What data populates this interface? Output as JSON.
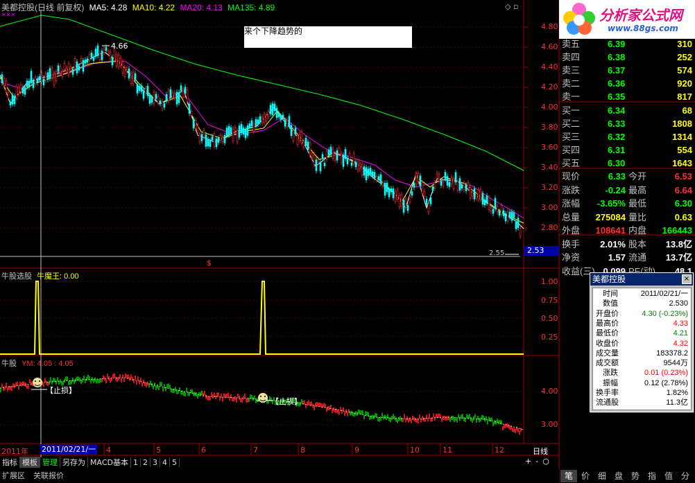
{
  "chart_header": {
    "title": "美都控股(日线 前复权)",
    "ma5": "MA5: 4.28",
    "ma10": "MA10: 4.22",
    "ma20": "MA20: 4.13",
    "ma135": "MA135: 4.89"
  },
  "annotation_text": "来个下降趋势的",
  "high_label": "4.66",
  "low_label": "2.55",
  "current_price_badge": "2.53",
  "dollar_marker": "$",
  "main_axis_ticks": [
    "4.80",
    "4.60",
    "4.40",
    "4.20",
    "4.00",
    "3.80",
    "3.60",
    "3.40",
    "3.20",
    "3.00",
    "2.80"
  ],
  "indicator1": {
    "title": "牛股选股",
    "sub": "牛魔王: 0.00",
    "ticks": [
      "1.00",
      "0.75",
      "0.50",
      "0.25"
    ]
  },
  "indicator2": {
    "title": "牛股",
    "sub": "YM: 4.05 : 4.05",
    "ticks": [
      "4.00",
      "3.00"
    ],
    "stop_label": "【止损】"
  },
  "date_axis": {
    "year": "2011年",
    "cursor": "2011/02/21/一",
    "months": [
      "4",
      "5",
      "6",
      "7",
      "8",
      "9",
      "10",
      "11",
      "12"
    ],
    "period": "日线"
  },
  "bottom_tabs": [
    "指标",
    "模板",
    "管理",
    "另存为",
    "MACD基本",
    "1",
    "2",
    "3",
    "4",
    "5"
  ],
  "bottom_tabs2": [
    "扩展区",
    "关联报价"
  ],
  "zoom_buttons": [
    "+",
    "-",
    "○"
  ],
  "logo": {
    "title": "分析家公式网",
    "url": "www.88gs.com"
  },
  "order_book": [
    {
      "label": "卖五",
      "price": "6.39",
      "vol": "310"
    },
    {
      "label": "卖四",
      "price": "6.38",
      "vol": "252"
    },
    {
      "label": "卖三",
      "price": "6.37",
      "vol": "574"
    },
    {
      "label": "卖二",
      "price": "6.36",
      "vol": "920"
    },
    {
      "label": "卖一",
      "price": "6.35",
      "vol": "817"
    },
    {
      "label": "买一",
      "price": "6.34",
      "vol": "68"
    },
    {
      "label": "买二",
      "price": "6.33",
      "vol": "1808"
    },
    {
      "label": "买三",
      "price": "6.32",
      "vol": "1314"
    },
    {
      "label": "买四",
      "price": "6.31",
      "vol": "554"
    },
    {
      "label": "买五",
      "price": "6.30",
      "vol": "1643"
    }
  ],
  "quote_stats": [
    {
      "k1": "现价",
      "v1": "6.33",
      "k2": "今开",
      "v2": "6.53"
    },
    {
      "k1": "涨跌",
      "v1": "-0.24",
      "k2": "最高",
      "v2": "6.64"
    },
    {
      "k1": "涨幅",
      "v1": "-3.65%",
      "k2": "最低",
      "v2": "6.30"
    },
    {
      "k1": "总量",
      "v1": "275084",
      "k2": "量比",
      "v2": "0.63"
    },
    {
      "k1": "外盘",
      "v1": "108641",
      "k2": "内盘",
      "v2": "166443"
    },
    {
      "k1": "换手",
      "v1": "2.01%",
      "k2": "股本",
      "v2": "13.8亿"
    },
    {
      "k1": "净资",
      "v1": "1.57",
      "k2": "流通",
      "v2": "13.7亿"
    },
    {
      "k1": "收益(三)",
      "v1": "0.099",
      "k2": "PE(动)",
      "v2": "48.1"
    }
  ],
  "tooltip": {
    "title": "美都控股",
    "close": "×",
    "rows": [
      {
        "k": "时间",
        "v": "2011/02/21/一",
        "c": "#000"
      },
      {
        "k": "数值",
        "v": "2.530",
        "c": "#000"
      },
      {
        "k": "开盘价",
        "v": "4.30 (-0.23%)",
        "c": "#008000"
      },
      {
        "k": "最高价",
        "v": "4.33",
        "c": "#ff0000"
      },
      {
        "k": "最低价",
        "v": "4.21",
        "c": "#008000"
      },
      {
        "k": "收盘价",
        "v": "4.32",
        "c": "#ff0000"
      },
      {
        "k": "成交量",
        "v": "183378.2",
        "c": "#000"
      },
      {
        "k": "成交额",
        "v": "9544万",
        "c": "#000"
      },
      {
        "k": "涨跌",
        "v": "0.01 (0.23%)",
        "c": "#ff0000"
      },
      {
        "k": "振幅",
        "v": "0.12 (2.78%)",
        "c": "#000"
      },
      {
        "k": "换手率",
        "v": "1.82%",
        "c": "#000"
      },
      {
        "k": "流通股",
        "v": "11.3亿",
        "c": "#000"
      }
    ]
  },
  "right_tabs": [
    "笔",
    "价",
    "细",
    "盘",
    "势",
    "指",
    "值",
    "分"
  ],
  "colors": {
    "up": "#ff3030",
    "down": "#00ffff",
    "ma5": "#ffffff",
    "ma10": "#ffff00",
    "ma20": "#ff00ff",
    "ma135": "#00ff00",
    "grid": "#800000",
    "axisText": "#ff3030"
  },
  "chart_data": {
    "type": "candlestick",
    "price_range": [
      2.53,
      4.66
    ],
    "indicator1_signals": [
      {
        "month": "2",
        "value": 1.0
      },
      {
        "month": "7",
        "value": 1.0
      }
    ]
  }
}
